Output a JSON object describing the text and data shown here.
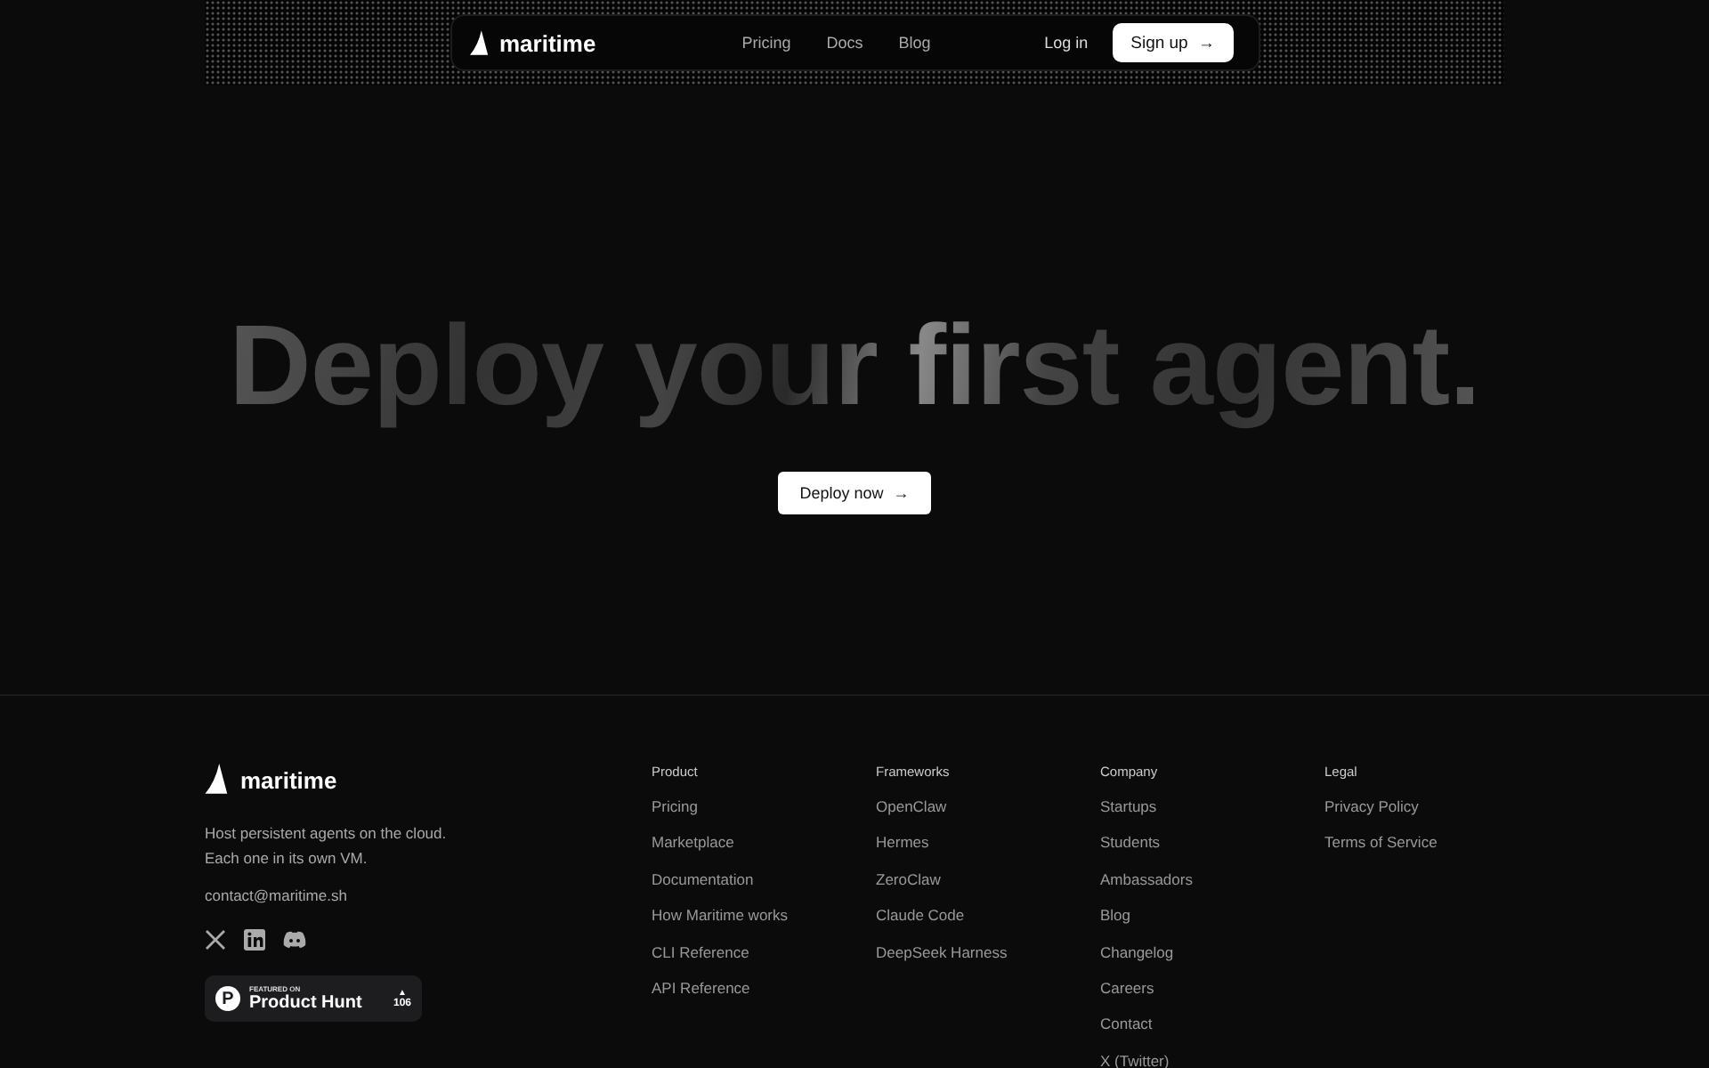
{
  "nav": {
    "brand": "maritime",
    "links": [
      "Pricing",
      "Docs",
      "Blog"
    ],
    "login": "Log in",
    "signup": "Sign up",
    "signup_arrow": "→"
  },
  "hero": {
    "headline": "Deploy your first agent.",
    "cta": "Deploy now",
    "cta_arrow": "→"
  },
  "footer": {
    "brand": "maritime",
    "tagline": [
      "Host persistent agents on the cloud.",
      "Each one in its own VM."
    ],
    "email": "contact@maritime.sh",
    "badge": {
      "kicker": "FEATURED ON",
      "name": "Product Hunt",
      "letter": "P",
      "arrow": "▲",
      "count": "106"
    },
    "columns": [
      {
        "heading": "Product",
        "links": [
          "Pricing",
          "Marketplace",
          "Documentation",
          "How Maritime works",
          "CLI Reference",
          "API Reference"
        ]
      },
      {
        "heading": "Frameworks",
        "links": [
          "OpenClaw",
          "Hermes",
          "ZeroClaw",
          "Claude Code",
          "DeepSeek Harness"
        ]
      },
      {
        "heading": "Company",
        "links": [
          "Startups",
          "Students",
          "Ambassadors",
          "Blog",
          "Changelog",
          "Careers",
          "Contact",
          "X (Twitter)"
        ]
      },
      {
        "heading": "Legal",
        "links": [
          "Privacy Policy",
          "Terms of Service"
        ]
      }
    ]
  }
}
